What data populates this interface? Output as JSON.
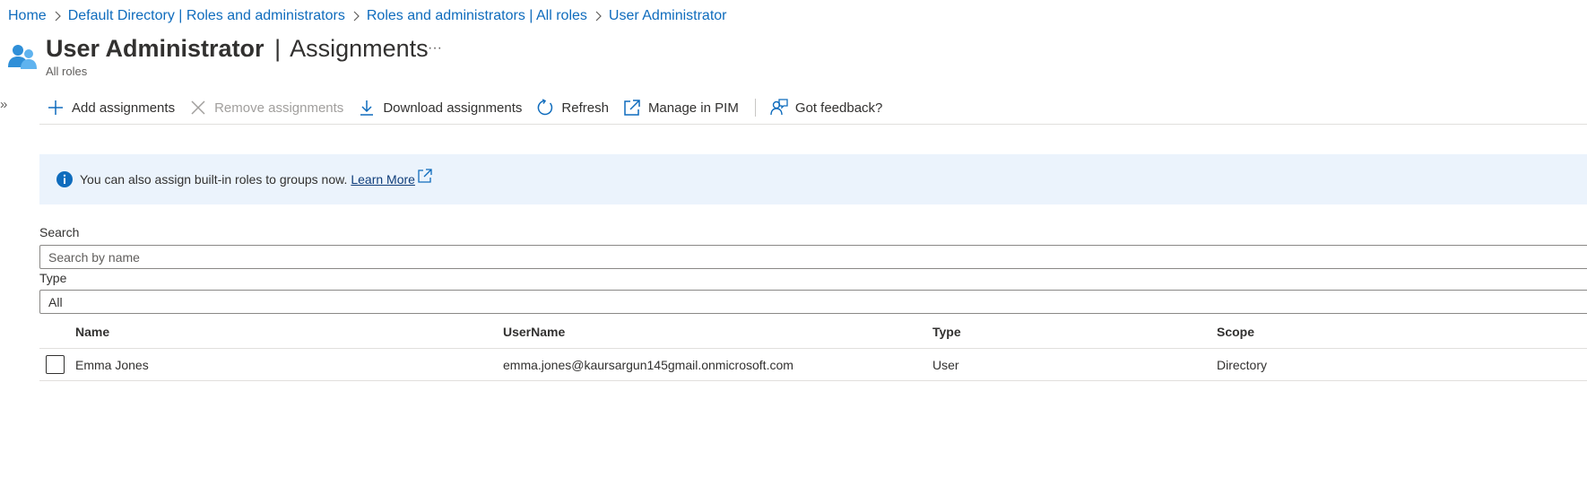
{
  "breadcrumb": [
    {
      "label": "Home"
    },
    {
      "label": "Default Directory | Roles and administrators"
    },
    {
      "label": "Roles and administrators | All roles"
    },
    {
      "label": "User Administrator"
    }
  ],
  "header": {
    "title_main": "User Administrator",
    "title_sep": "|",
    "title_sub": "Assignments",
    "more_label": "···",
    "subtitle": "All roles",
    "icon": "user-group-icon"
  },
  "toolbar": {
    "add": {
      "label": "Add assignments",
      "icon": "plus-icon"
    },
    "remove": {
      "label": "Remove assignments",
      "icon": "x-icon",
      "disabled": true
    },
    "download": {
      "label": "Download assignments",
      "icon": "download-icon"
    },
    "refresh": {
      "label": "Refresh",
      "icon": "refresh-icon"
    },
    "pim": {
      "label": "Manage in PIM",
      "icon": "external-link-icon"
    },
    "feedback": {
      "label": "Got feedback?",
      "icon": "feedback-icon"
    }
  },
  "banner": {
    "text": "You can also assign built-in roles to groups now.",
    "link": "Learn More",
    "icon": "info-icon"
  },
  "filters": {
    "search_label": "Search",
    "search_placeholder": "Search by name",
    "search_value": "",
    "type_label": "Type",
    "type_value": "All"
  },
  "table": {
    "columns": {
      "name": "Name",
      "username": "UserName",
      "type": "Type",
      "scope": "Scope"
    },
    "rows": [
      {
        "name": "Emma Jones",
        "username": "emma.jones@kaursargun145gmail.onmicrosoft.com",
        "type": "User",
        "scope": "Directory",
        "checked": false
      }
    ]
  },
  "colors": {
    "link": "#0f6cbd",
    "banner_bg": "#ebf3fc",
    "info": "#0f6cbd",
    "disabled": "#a19f9d"
  }
}
